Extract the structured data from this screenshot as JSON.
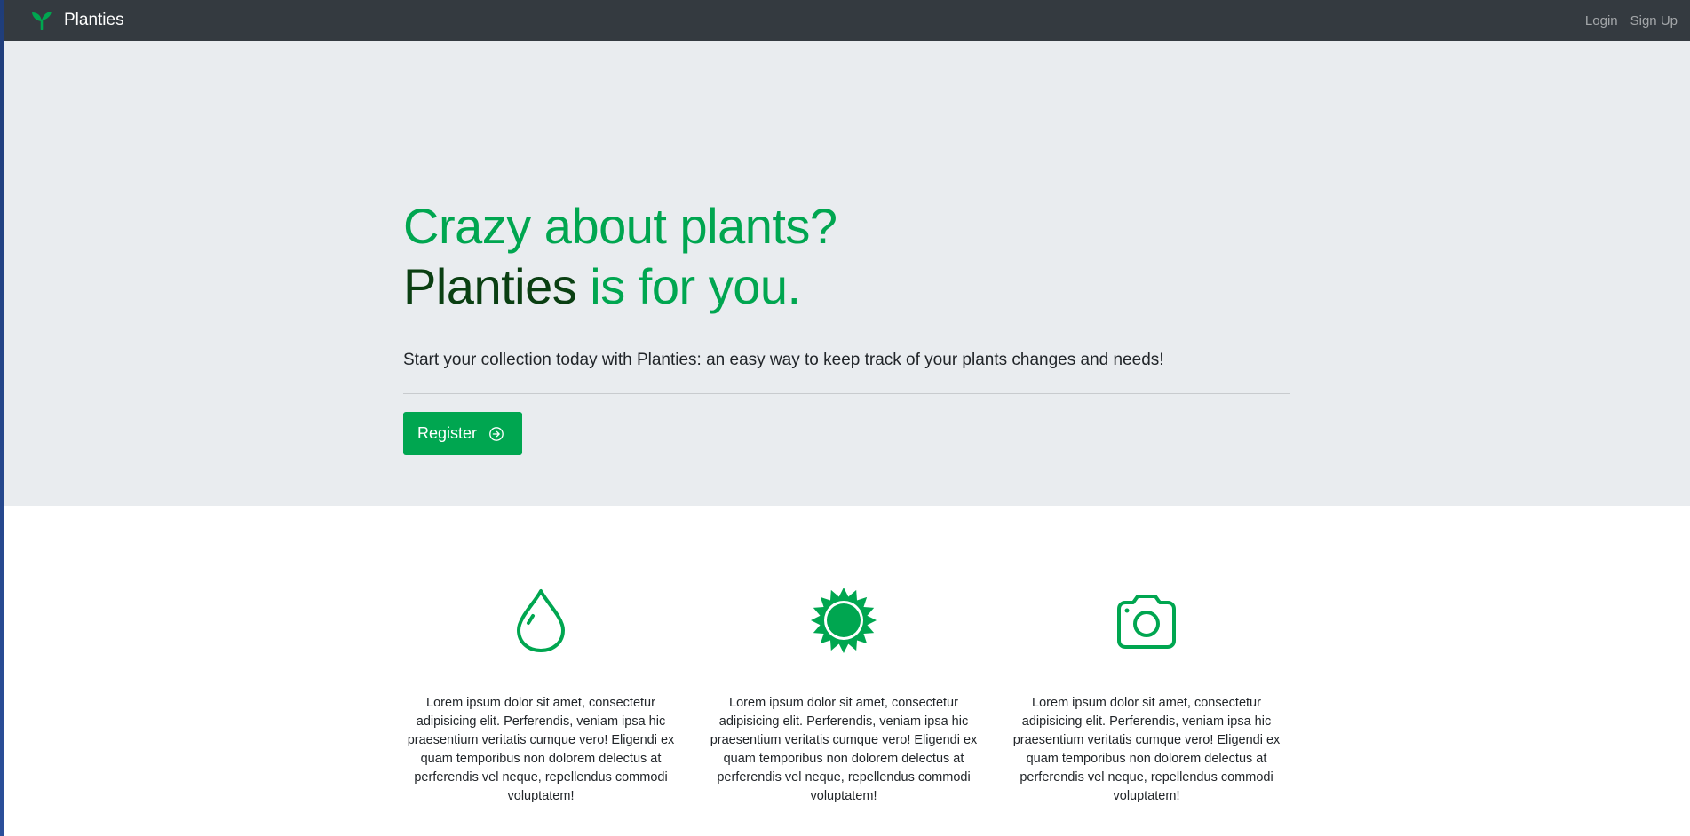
{
  "navbar": {
    "brand_icon": "sprout-icon",
    "brand_name": "Planties",
    "links": [
      "Login",
      "Sign Up"
    ]
  },
  "hero": {
    "headline_line1": "Crazy about plants?",
    "headline_brand": "Planties",
    "headline_rest": " is for you.",
    "lead": "Start your collection today with Planties: an easy way to keep track of your plants changes and needs!",
    "register_label": "Register",
    "register_icon": "arrow-right-circle-icon"
  },
  "features": [
    {
      "icon": "water-drop-icon",
      "text": "Lorem ipsum dolor sit amet, consectetur adipisicing elit. Perferendis, veniam ipsa hic praesentium veritatis cumque vero! Eligendi ex quam temporibus non dolorem delectus at perferendis vel neque, repellendus commodi voluptatem!"
    },
    {
      "icon": "sun-icon",
      "text": "Lorem ipsum dolor sit amet, consectetur adipisicing elit. Perferendis, veniam ipsa hic praesentium veritatis cumque vero! Eligendi ex quam temporibus non dolorem delectus at perferendis vel neque, repellendus commodi voluptatem!"
    },
    {
      "icon": "camera-icon",
      "text": "Lorem ipsum dolor sit amet, consectetur adipisicing elit. Perferendis, veniam ipsa hic praesentium veritatis cumque vero! Eligendi ex quam temporibus non dolorem delectus at perferendis vel neque, repellendus commodi voluptatem!"
    }
  ],
  "colors": {
    "accent": "#00a650",
    "brand_dark": "#0a3f12",
    "navbar_bg": "#343a40",
    "hero_bg": "#e9ecef"
  }
}
